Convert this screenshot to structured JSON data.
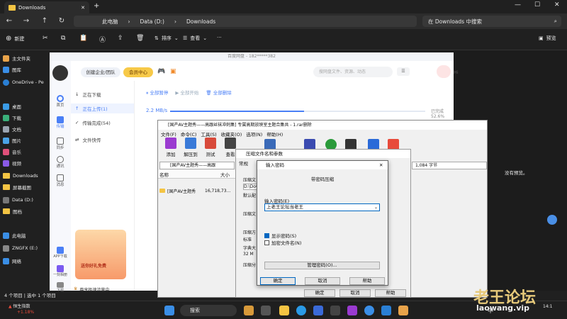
{
  "explorer": {
    "tab_title": "Downloads",
    "breadcrumb": [
      "此电脑",
      "Data (D:)",
      "Downloads"
    ],
    "search_placeholder": "在 Downloads 中搜索",
    "commands": {
      "new": "新建",
      "sort": "排序",
      "view": "查看",
      "preview": "预览"
    },
    "sidebar": [
      "主文件夹",
      "图库",
      "OneDrive - Pe",
      "桌面",
      "下载",
      "文档",
      "图片",
      "音乐",
      "视频",
      "Downloads",
      "屏幕截图",
      "Data (D:)",
      "图档",
      "此电脑",
      "ZNGFX (E:)",
      "网络"
    ],
    "status": "4 个项目 | 选中 1 个项目",
    "preview_msg": "没有预览。"
  },
  "baidu": {
    "title": "百度网盘 - 182*****382",
    "enterprise_btn": "创建企业/团队",
    "member_btn": "会员中心",
    "search_placeholder": "搜网盘文件、资源、动态",
    "user": "Hi",
    "left_icons": [
      "首页",
      "传输",
      "同步",
      "通讯",
      "消息",
      "APP下载",
      "一刻相册",
      "下载"
    ],
    "nav": [
      "正在下载",
      "正在上传(1)",
      "传输完成(54)",
      "文件快传"
    ],
    "actions": [
      "全部暂停",
      "全部开始",
      "全部删除"
    ],
    "speed": "2.2 MB/s",
    "progress_text": "已完成52.6%",
    "progress": 0.526,
    "promo": "尊享极速流量中",
    "gift": "送你好礼免费"
  },
  "winrar": {
    "title": "[国产AV主题秀——高跟丝袜冲刺集] 专属高期放映室主题合集共 - 1.rar删除",
    "menu": [
      "文件(F)",
      "命令(C)",
      "工具(S)",
      "收藏夹(O)",
      "选项(N)",
      "帮助(H)"
    ],
    "tools": [
      "添加",
      "解压到",
      "测试",
      "查看"
    ],
    "path": "[国产AV主题秀——高跟",
    "size_right": "1,084 字节",
    "col_name": "名称",
    "col_size": "大小",
    "row_name": "[国产AV主题秀",
    "row_size": "16,718,73..."
  },
  "archive_dialog": {
    "title": "压缩文件名和参数",
    "tab": "常规",
    "labels": [
      "压缩文",
      "D:\\Dow",
      "默认配",
      "压缩文",
      "压缩方",
      "标准",
      "字典大",
      "32 M",
      "压缩分"
    ],
    "ok": "确定",
    "cancel": "取消",
    "help": "帮助"
  },
  "password_dialog": {
    "title": "输入密码",
    "heading": "带密码压缩",
    "label": "输入密码(E)",
    "value": "上老王论坛当老王",
    "show_pwd": "显示密码(S)",
    "show_checked": true,
    "encrypt_names": "加密文件名(N)",
    "encrypt_checked": false,
    "manage": "管理密码(O)...",
    "ok": "确定",
    "cancel": "取消",
    "help": "帮助"
  },
  "taskbar": {
    "weather": "恒生指数",
    "weather_sub": "+1.18%",
    "search": "搜索",
    "ime": "中",
    "time": "14:1"
  },
  "watermark": {
    "cn": "老王论坛",
    "en": "laowang.vip"
  }
}
